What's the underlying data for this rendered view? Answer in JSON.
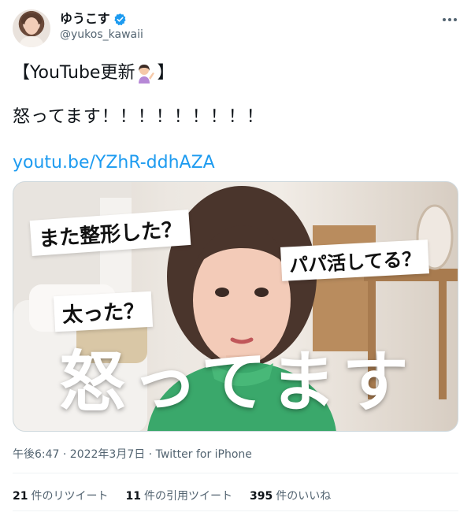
{
  "author": {
    "display_name": "ゆうこす",
    "handle": "@yukos_kawaii",
    "verified": true
  },
  "tweet": {
    "line1_prefix": "【YouTube更新",
    "line1_emoji": "woman-tipping-hand-emoji",
    "line1_suffix": "】",
    "line2": "怒ってます！！！！！！！！！",
    "link": "youtu.be/YZhR-ddhAZA"
  },
  "thumbnail": {
    "caption1": "また整形した？",
    "caption2": "パパ活してる？",
    "caption3": "太った？",
    "title": "怒ってます"
  },
  "meta": {
    "timestamp": "午後6:47 · 2022年3月7日 · Twitter for iPhone"
  },
  "stats": {
    "retweets_count": "21",
    "retweets_label": "件のリツイート",
    "quotes_count": "11",
    "quotes_label": "件の引用ツイート",
    "likes_count": "395",
    "likes_label": "件のいいね"
  },
  "colors": {
    "link": "#1d9bf0",
    "secondary_text": "#536471",
    "verified": "#1d9bf0",
    "sweater": "#3aa86b"
  }
}
